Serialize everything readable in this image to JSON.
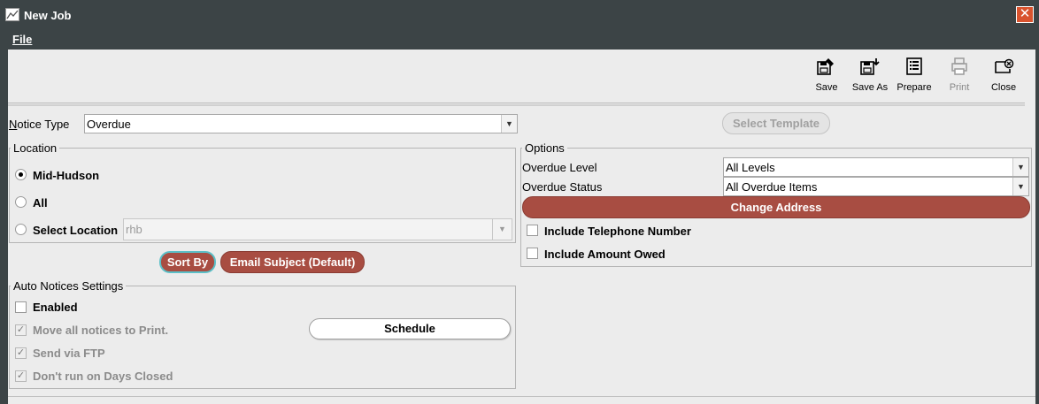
{
  "window": {
    "title": "New Job"
  },
  "menu": {
    "file": "File"
  },
  "toolbar": {
    "save": "Save",
    "save_as": "Save As",
    "prepare": "Prepare",
    "print": "Print",
    "close": "Close"
  },
  "notice_type": {
    "label": "Notice Type",
    "value": "Overdue"
  },
  "select_template": "Select Template",
  "location": {
    "title": "Location",
    "option_mid_hudson": "Mid-Hudson",
    "option_all": "All",
    "option_select_location": "Select Location",
    "select_location_value": "rhb",
    "selected": "Mid-Hudson"
  },
  "buttons": {
    "sort_by": "Sort By",
    "email_subject": "Email Subject (Default)",
    "schedule": "Schedule",
    "change_address": "Change Address"
  },
  "auto_notices": {
    "title": "Auto Notices Settings",
    "enabled": "Enabled",
    "move_all": "Move all notices to Print.",
    "send_ftp": "Send via FTP",
    "dont_run": "Don't run on Days Closed"
  },
  "options": {
    "title": "Options",
    "overdue_level_label": "Overdue Level",
    "overdue_level_value": "All Levels",
    "overdue_status_label": "Overdue Status",
    "overdue_status_value": "All Overdue Items",
    "include_telephone": "Include Telephone Number",
    "include_amount": "Include Amount Owed"
  },
  "colors": {
    "accent_button": "#a84d42",
    "title_bar": "#3c4446",
    "focus_ring": "#5bc0c8"
  }
}
